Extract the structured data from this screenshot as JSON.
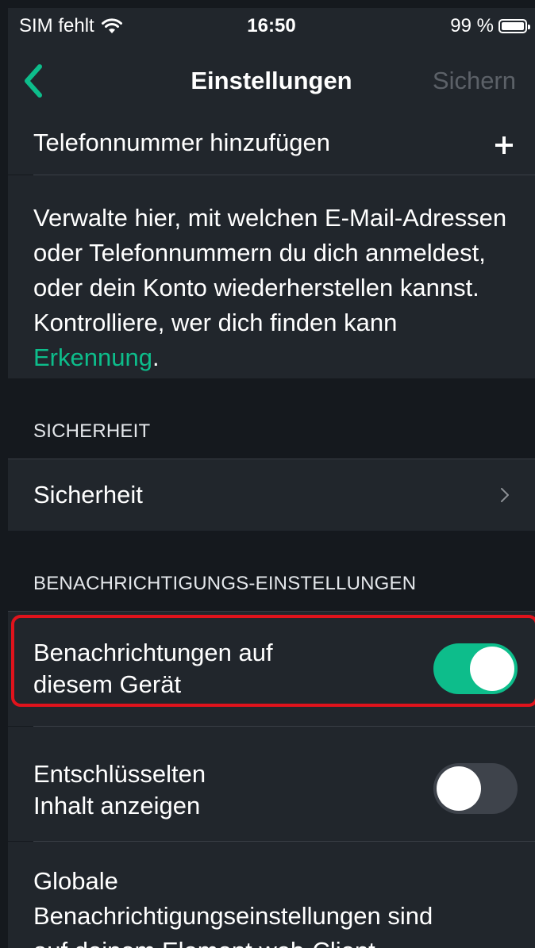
{
  "status_bar": {
    "carrier": "SIM fehlt",
    "time": "16:50",
    "battery": "99 %"
  },
  "nav": {
    "title": "Einstellungen",
    "save_label": "Sichern"
  },
  "email_phone": {
    "add_phone_label": "Telefonnummer hinzufügen",
    "description": "Verwalte hier, mit welchen E-Mail-Adressen oder Telefonnummern du dich anmeldest, oder dein Konto wiederherstellen kannst. Kontrolliere, wer dich finden kann",
    "description_link": "Erkennung",
    "description_suffix": "."
  },
  "security_section": {
    "header": "SICHERHEIT",
    "item_label": "Sicherheit"
  },
  "notifications_section": {
    "header": "BENACHRICHTIGUNGS-EINSTELLUNGEN",
    "items": [
      {
        "label_line1": "Benachrichtungen auf",
        "label_line2": "diesem Gerät",
        "enabled": true
      },
      {
        "label_line1": "Entschlüsselten",
        "label_line2": "Inhalt anzeigen",
        "enabled": false
      }
    ],
    "global_text_line1": "Globale",
    "global_text_line2": "Benachrichtigungseinstellungen sind",
    "global_text_line3": "auf deinem Element web-Client"
  },
  "colors": {
    "accent": "#0dbd8b",
    "background": "#15191e",
    "row_background": "#21262c",
    "highlight_border": "#e0131c"
  }
}
